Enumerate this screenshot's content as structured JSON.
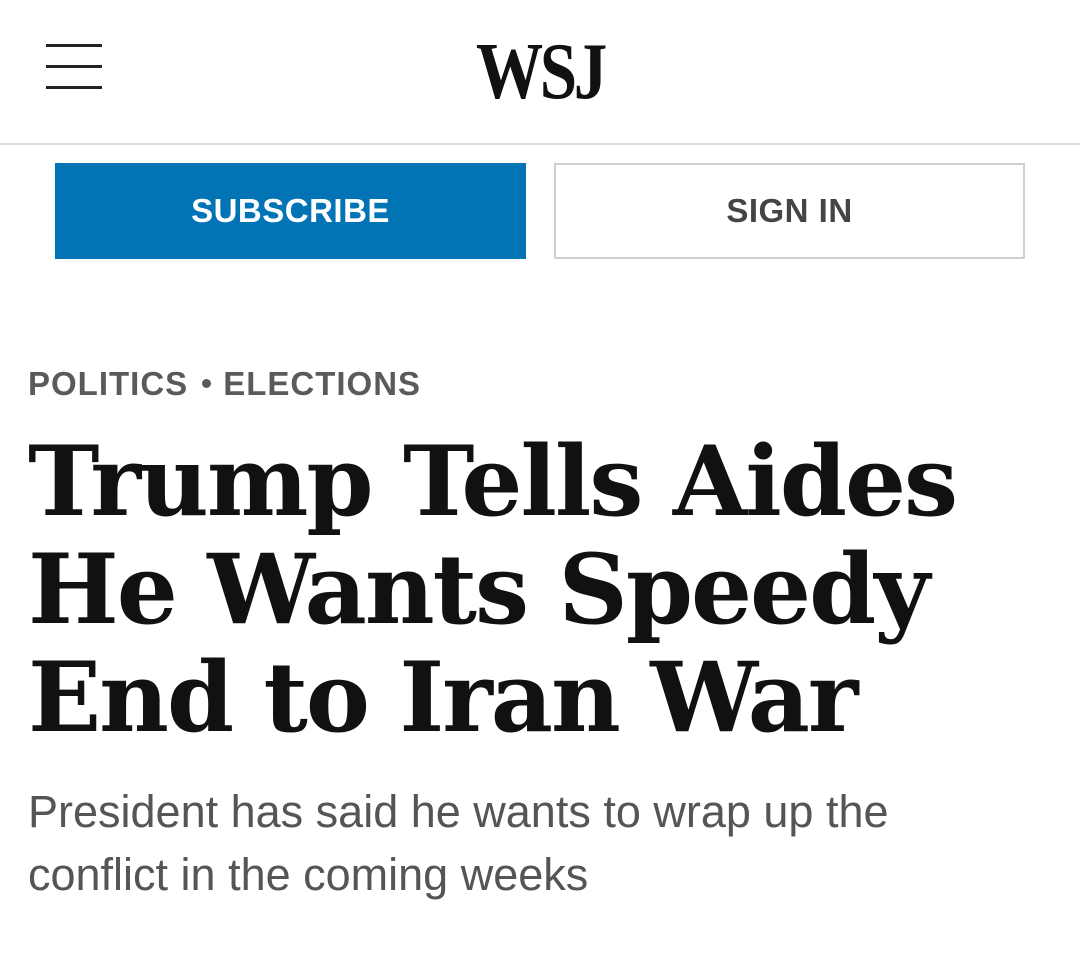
{
  "header": {
    "logo_text": "WSJ",
    "menu_icon": "hamburger-menu-icon"
  },
  "actions": {
    "subscribe_label": "SUBSCRIBE",
    "signin_label": "SIGN IN"
  },
  "article": {
    "kicker": {
      "section": "POLITICS",
      "subsection": "ELECTIONS"
    },
    "headline": "Trump Tells Aides He Wants Speedy End to Iran War",
    "dek": "President has said he wants to wrap up the conflict in the coming weeks"
  },
  "colors": {
    "subscribe_bg": "#0274b6",
    "text": "#111111",
    "muted": "#555555"
  }
}
